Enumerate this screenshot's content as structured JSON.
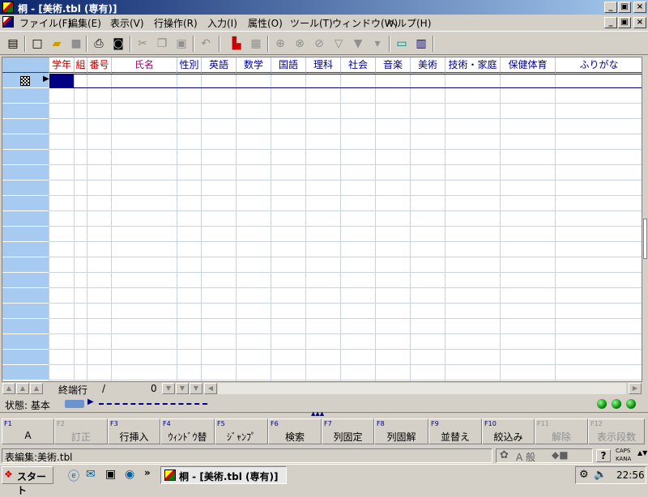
{
  "window": {
    "title": "桐 - [美術.tbl (専有)]"
  },
  "window_controls": {
    "minimize": "_",
    "restore": "▣",
    "close": "×"
  },
  "menu": [
    "ファイル(F)",
    "編集(E)",
    "表示(V)",
    "行操作(R)",
    "入力(I)",
    "属性(O)",
    "ツール(T)",
    "ウィンドウ(W)",
    "ヘルプ(H)"
  ],
  "toolbar_icons": [
    "table-view-icon",
    "new-icon",
    "open-icon",
    "save-icon",
    "print-icon",
    "print-preview-icon",
    "cut-icon",
    "copy-icon",
    "paste-icon",
    "undo-icon",
    "chart-bar-icon",
    "sort-icon",
    "search-icon",
    "search-next-icon",
    "replace-icon",
    "filter-icon",
    "filter-on-icon",
    "filter-off-icon",
    "form-icon",
    "graph-icon"
  ],
  "grid": {
    "columns": [
      "学年",
      "組",
      "番号",
      "氏名",
      "性別",
      "英語",
      "数学",
      "国語",
      "理科",
      "社会",
      "音楽",
      "美術",
      "技術・家庭",
      "保健体育",
      "ふりがな"
    ],
    "current_row_marker": "▶"
  },
  "bottom": {
    "end_row_label": "終端行",
    "separator": "/",
    "count": "0"
  },
  "status": {
    "state": "状態: 基本"
  },
  "fkeys": [
    {
      "fn": "F1",
      "label": "A",
      "enabled": true
    },
    {
      "fn": "F2",
      "label": "訂正",
      "enabled": false
    },
    {
      "fn": "F3",
      "label": "行挿入",
      "enabled": true
    },
    {
      "fn": "F4",
      "label": "ｳｨﾝﾄﾞｳ替",
      "enabled": true
    },
    {
      "fn": "F5",
      "label": "ｼﾞｬﾝﾌﾟ",
      "enabled": true
    },
    {
      "fn": "F6",
      "label": "検索",
      "enabled": true
    },
    {
      "fn": "F7",
      "label": "列固定",
      "enabled": true
    },
    {
      "fn": "F8",
      "label": "列固解",
      "enabled": true
    },
    {
      "fn": "F9",
      "label": "並替え",
      "enabled": true
    },
    {
      "fn": "F10",
      "label": "絞込み",
      "enabled": true
    },
    {
      "fn": "F11",
      "label": "解除",
      "enabled": false
    },
    {
      "fn": "F12",
      "label": "表示段数",
      "enabled": false
    }
  ],
  "statusbar": {
    "text": "表編集:美術.tbl",
    "ime_mode": "A 般",
    "caps": "CAPS",
    "kana": "KANA"
  },
  "taskbar": {
    "start": "スタート",
    "task": "桐 - [美術.tbl (専有)]",
    "chevron": "»",
    "time": "22:56"
  }
}
